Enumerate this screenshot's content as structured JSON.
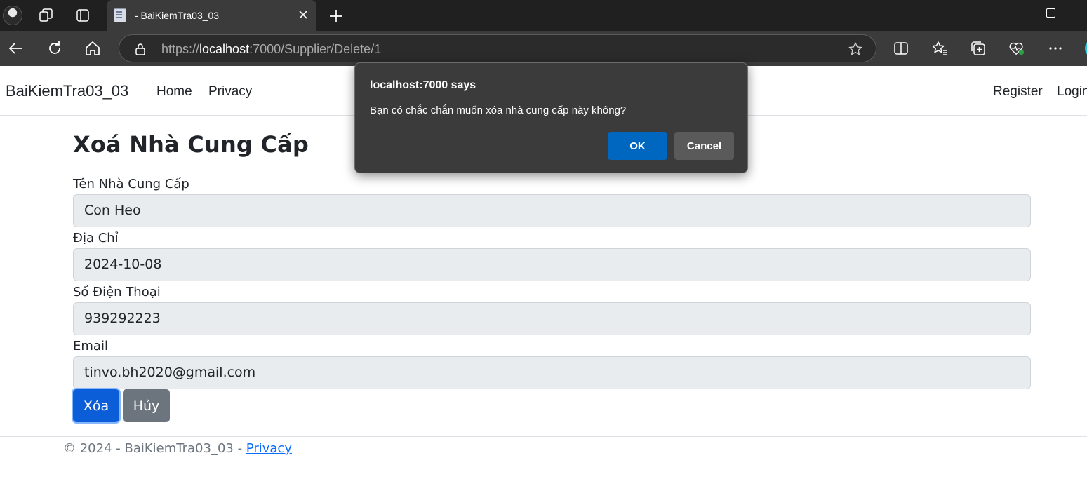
{
  "browser": {
    "tab_title": "- BaiKiemTra03_03",
    "url_prefix": "https://",
    "url_host": "localhost",
    "url_rest": ":7000/Supplier/Delete/1"
  },
  "site": {
    "brand": "BaiKiemTra03_03",
    "nav": {
      "home": "Home",
      "privacy": "Privacy",
      "register": "Register",
      "login": "Login"
    }
  },
  "page": {
    "title": "Xoá Nhà Cung Cấp",
    "fields": [
      {
        "label": "Tên Nhà Cung Cấp",
        "value": "Con Heo"
      },
      {
        "label": "Địa Chỉ",
        "value": "2024-10-08"
      },
      {
        "label": "Số Điện Thoại",
        "value": "939292223"
      },
      {
        "label": "Email",
        "value": "tinvo.bh2020@gmail.com"
      }
    ],
    "delete_button": "Xóa",
    "cancel_button": "Hủy"
  },
  "footer": {
    "text": "© 2024 - BaiKiemTra03_03 - ",
    "link": "Privacy"
  },
  "dialog": {
    "title": "localhost:7000 says",
    "message": "Bạn có chắc chắn muốn xóa nhà cung cấp này không?",
    "ok": "OK",
    "cancel": "Cancel"
  },
  "colors": {
    "primary": "#0b5ed7",
    "secondary": "#6c757d",
    "input_bg": "#e9ecef",
    "dialog_bg": "#3b3b3b",
    "dialog_ok": "#0067c0"
  },
  "icons": [
    "profile-avatar-icon",
    "workspaces-icon",
    "tab-actions-icon",
    "page-favicon-icon",
    "close-icon",
    "plus-icon",
    "minimize-icon",
    "maximize-icon",
    "back-arrow-icon",
    "reload-icon",
    "home-icon",
    "lock-icon",
    "star-icon",
    "split-screen-icon",
    "favorites-icon",
    "collections-icon",
    "browser-essentials-icon",
    "more-icon",
    "copilot-icon"
  ]
}
